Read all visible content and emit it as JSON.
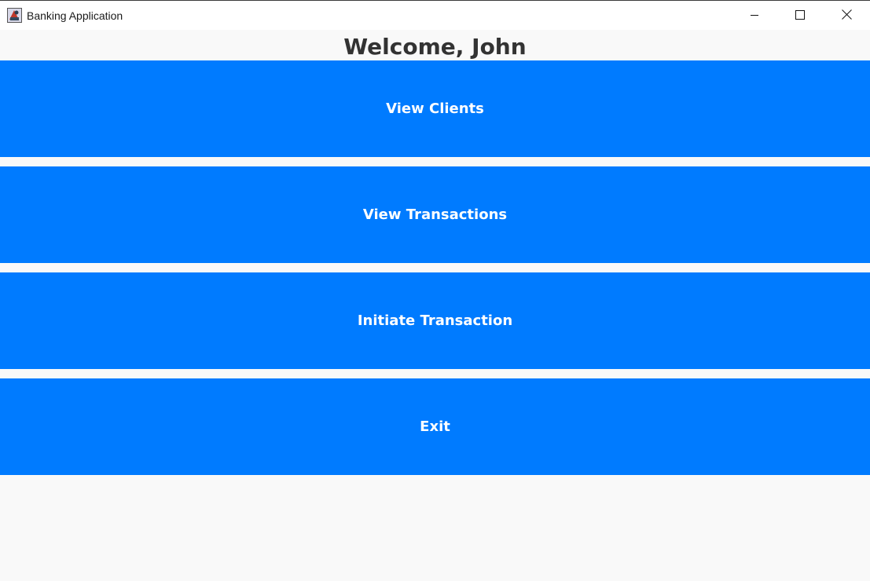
{
  "window": {
    "title": "Banking Application",
    "app_icon": "java-app-icon",
    "controls": {
      "minimize_icon": "minimize-icon",
      "maximize_icon": "maximize-icon",
      "close_icon": "close-icon"
    }
  },
  "header": {
    "welcome_text": "Welcome, John"
  },
  "menu": {
    "view_clients_label": "View Clients",
    "view_transactions_label": "View Transactions",
    "initiate_transaction_label": "Initiate Transaction",
    "exit_label": "Exit"
  },
  "colors": {
    "accent": "#007bff",
    "background": "#f9f9f9",
    "heading": "#333333",
    "button_text": "#ffffff"
  }
}
